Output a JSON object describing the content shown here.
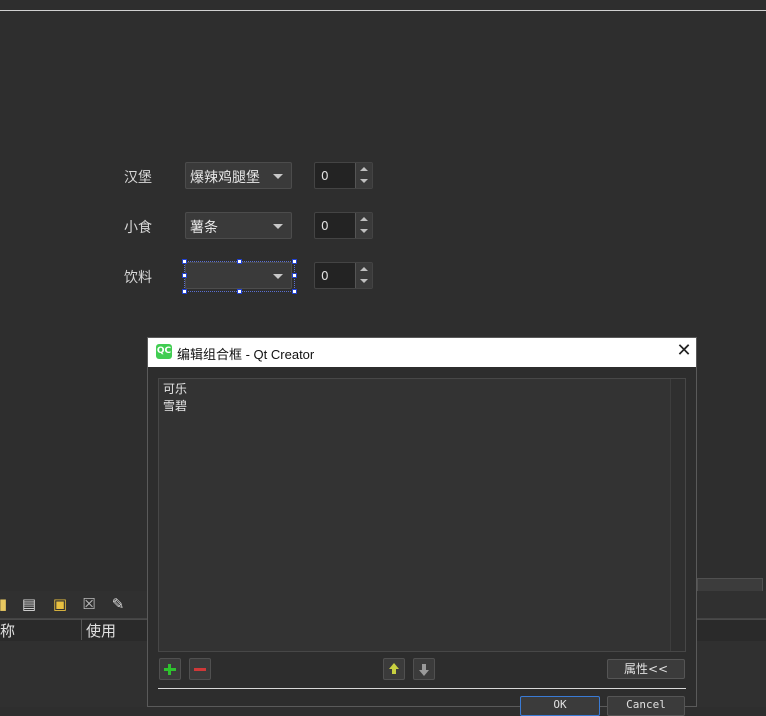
{
  "form": {
    "rows": [
      {
        "label": "汉堡",
        "combo_value": "爆辣鸡腿堡",
        "spin_value": "0"
      },
      {
        "label": "小食",
        "combo_value": "薯条",
        "spin_value": "0"
      },
      {
        "label": "饮料",
        "combo_value": "",
        "spin_value": "0"
      }
    ]
  },
  "bottom_panel": {
    "columns": [
      "称",
      "使用"
    ],
    "toolbar_icons": [
      "new-file-icon",
      "open-file-icon",
      "paste-file-icon",
      "delete-icon",
      "wrench-icon"
    ]
  },
  "dialog": {
    "title": "编辑组合框 - Qt Creator",
    "logo_text": "QC",
    "close_glyph": "✕",
    "items": [
      "可乐",
      "雪碧"
    ],
    "properties_label": "属性<<",
    "ok_label": "OK",
    "cancel_label": "Cancel"
  }
}
